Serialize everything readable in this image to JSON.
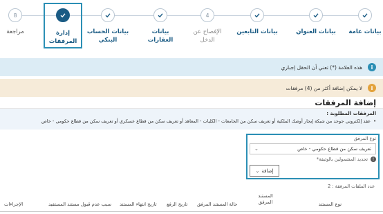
{
  "stepper": {
    "steps": [
      {
        "label": "بيانات عامة",
        "state": "done",
        "marker": "check"
      },
      {
        "label": "بيانات العنوان",
        "state": "done",
        "marker": "check"
      },
      {
        "label": "بيانات التابعين",
        "state": "done",
        "marker": "check"
      },
      {
        "label": "الإفصاح عن الدخل",
        "state": "muted",
        "marker": "4"
      },
      {
        "label": "بيانات العقارات",
        "state": "done",
        "marker": "check"
      },
      {
        "label": "بيانات الحساب البنكي",
        "state": "done",
        "marker": "check"
      },
      {
        "label": "إدارة المرفقات",
        "state": "active",
        "marker": "check"
      },
      {
        "label": "مراجعة",
        "state": "pending",
        "marker": "8"
      }
    ]
  },
  "alerts": {
    "required_note": "هذه العلامة (*) تعني أن الحقل إجباري",
    "max_attachments": "لا يمكن إضافة أكثر من (4) مرفقات"
  },
  "attachments": {
    "section_title": "إضافة المرفقات",
    "required_title": "المرفقات المطلوبة :",
    "required_item": "عقد إلكتروني جوجد من شبكة إيجار أوصك الملكية أو تعريف سكن من الجامعات - الكليات - المعاهد أو تعريف سكن من قطاع عسكري أو تعريف سكن من قطاع حكومي - خاص"
  },
  "form": {
    "type_label": "نوع المرفق",
    "type_value": "تعريف سكن من قطاع حكومي - خاص",
    "hint": "تحديد المشمولين بالوثيقة*",
    "add_label": "إضافة"
  },
  "table": {
    "count_label": "عدد الملفات المرفقة : 2",
    "headers": [
      "نوع المستند",
      "المستند المرفق",
      "حالة المستند المرفق",
      "تاريخ الرفع",
      "تاريخ انتهاء المستند",
      "سبب عدم قبول مستند المستفيد",
      "الإجراءات"
    ]
  },
  "colors": {
    "primary": "#1a5b84",
    "accent_outline": "#2b8fb5",
    "info_bg": "#dcecf5",
    "warn_bg": "#f6ebd9",
    "warn_icon": "#e3a23b"
  }
}
